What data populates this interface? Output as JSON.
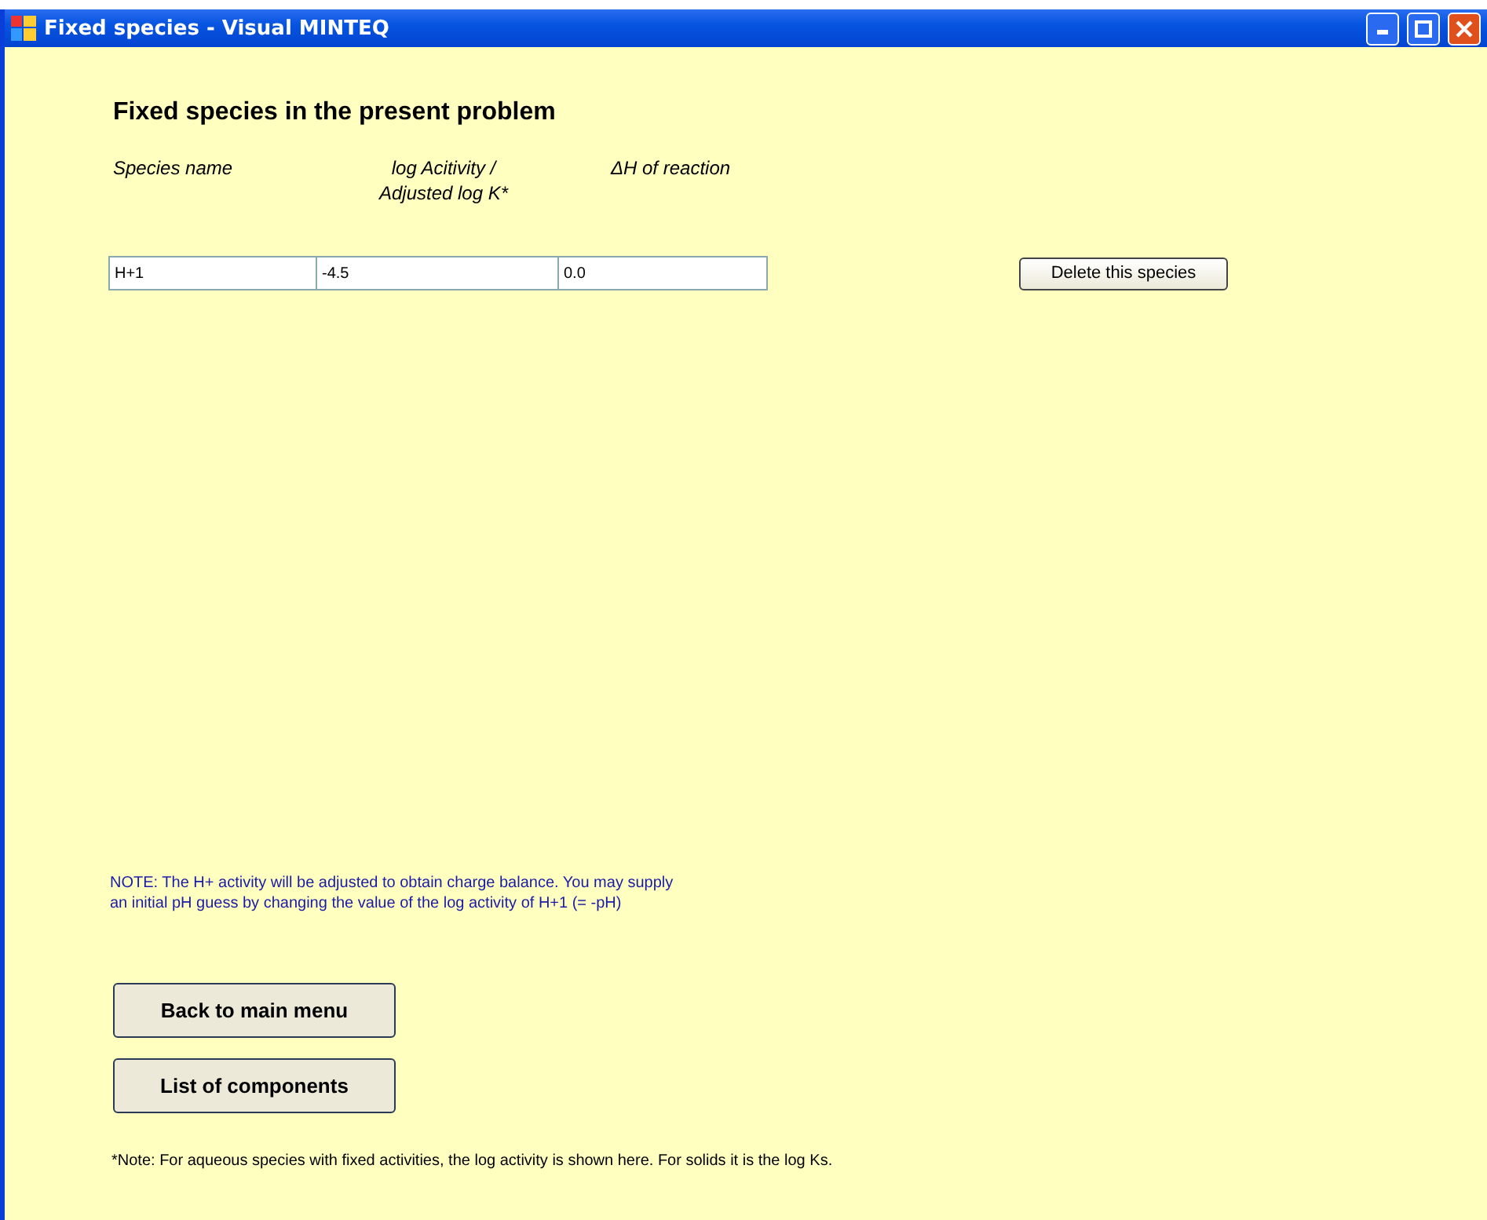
{
  "window": {
    "title": "Fixed species - Visual MINTEQ"
  },
  "heading": "Fixed species in the present problem",
  "columns": [
    "Species name",
    "log Acitivity /\nAdjusted log K*",
    "ΔH of reaction"
  ],
  "rows": [
    {
      "cells": [
        "H+1",
        "-4.5",
        "0.0"
      ],
      "action": "Delete this species"
    }
  ],
  "note": "NOTE: The H+ activity will be adjusted to obtain charge balance. You may supply\nan initial pH guess by changing the value of the log activity of H+1 (= -pH)",
  "buttons": [
    "Back to main menu",
    "List of components"
  ],
  "footnote": "*Note: For aqueous species with fixed activities, the log activity is shown here. For solids it is the log Ks."
}
